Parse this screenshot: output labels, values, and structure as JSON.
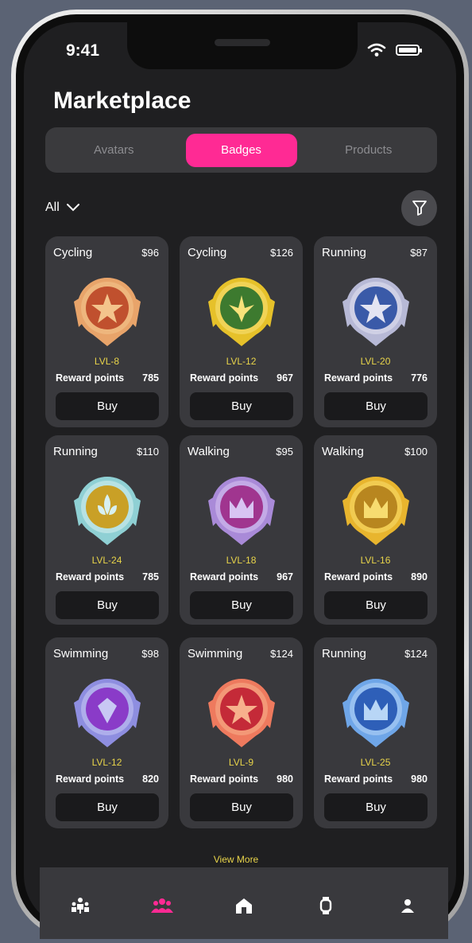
{
  "status": {
    "time": "9:41"
  },
  "header": {
    "title": "Marketplace"
  },
  "tabs": [
    {
      "label": "Avatars",
      "active": false
    },
    {
      "label": "Badges",
      "active": true
    },
    {
      "label": "Products",
      "active": false
    }
  ],
  "filter": {
    "selected": "All"
  },
  "items": [
    {
      "sport": "Cycling",
      "price": "$96",
      "level": "LVL-8",
      "reward_label": "Reward points",
      "reward": "785",
      "buy": "Buy",
      "badge": "bronze-star-badge",
      "colors": [
        "#c0502e",
        "#e8a46a",
        "#f3c48c"
      ]
    },
    {
      "sport": "Cycling",
      "price": "$126",
      "level": "LVL-12",
      "reward_label": "Reward points",
      "reward": "967",
      "buy": "Buy",
      "badge": "gold-eagle-badge",
      "colors": [
        "#3d7a2f",
        "#e6c12a",
        "#f8e27a"
      ]
    },
    {
      "sport": "Running",
      "price": "$87",
      "level": "LVL-20",
      "reward_label": "Reward points",
      "reward": "776",
      "buy": "Buy",
      "badge": "silver-star-badge",
      "colors": [
        "#3a5aa8",
        "#b7b9d6",
        "#e3e4f2"
      ]
    },
    {
      "sport": "Running",
      "price": "$110",
      "level": "LVL-24",
      "reward_label": "Reward points",
      "reward": "785",
      "buy": "Buy",
      "badge": "fleur-de-lis-badge",
      "colors": [
        "#c9a026",
        "#8fd0d4",
        "#d8f0f0"
      ]
    },
    {
      "sport": "Walking",
      "price": "$95",
      "level": "LVL-18",
      "reward_label": "Reward points",
      "reward": "967",
      "buy": "Buy",
      "badge": "purple-crown-badge",
      "colors": [
        "#a0358f",
        "#a98ad8",
        "#d8c4f2"
      ]
    },
    {
      "sport": "Walking",
      "price": "$100",
      "level": "LVL-16",
      "reward_label": "Reward points",
      "reward": "890",
      "buy": "Buy",
      "badge": "gold-crown-badge",
      "colors": [
        "#b8861f",
        "#e8b52e",
        "#f7dc70"
      ]
    },
    {
      "sport": "Swimming",
      "price": "$98",
      "level": "LVL-12",
      "reward_label": "Reward points",
      "reward": "820",
      "buy": "Buy",
      "badge": "purple-gem-badge",
      "colors": [
        "#8a3bc8",
        "#8e8ee0",
        "#c8c8f4"
      ]
    },
    {
      "sport": "Swimming",
      "price": "$124",
      "level": "LVL-9",
      "reward_label": "Reward points",
      "reward": "980",
      "buy": "Buy",
      "badge": "red-star-badge",
      "colors": [
        "#c42a38",
        "#ee7a5e",
        "#f7b08c"
      ]
    },
    {
      "sport": "Running",
      "price": "$124",
      "level": "LVL-25",
      "reward_label": "Reward points",
      "reward": "980",
      "buy": "Buy",
      "badge": "blue-crown-badge",
      "colors": [
        "#2e5fb8",
        "#6fa6e8",
        "#b8d6f6"
      ]
    }
  ],
  "view_more": "View More",
  "nav": [
    {
      "icon": "community-icon",
      "active": false
    },
    {
      "icon": "group-icon",
      "active": true
    },
    {
      "icon": "home-icon",
      "active": false
    },
    {
      "icon": "watch-icon",
      "active": false
    },
    {
      "icon": "profile-icon",
      "active": false
    }
  ],
  "colors": {
    "accent": "#ff2a94",
    "level": "#e8d44a"
  }
}
